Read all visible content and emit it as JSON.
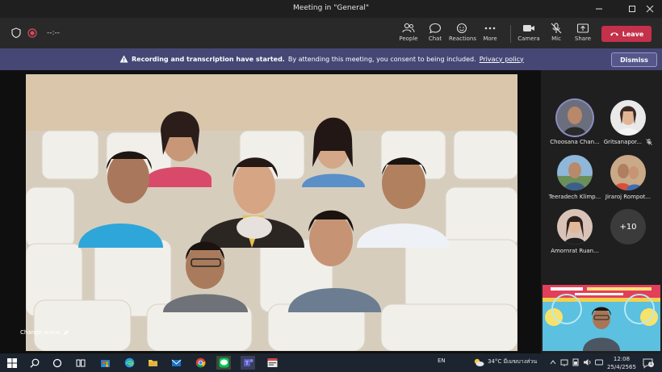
{
  "window": {
    "title": "Meeting in \"General\""
  },
  "toolbar": {
    "timer": "--:--",
    "people_label": "People",
    "chat_label": "Chat",
    "reactions_label": "Reactions",
    "more_label": "More",
    "camera_label": "Camera",
    "mic_label": "Mic",
    "share_label": "Share",
    "leave_label": "Leave"
  },
  "banner": {
    "bold": "Recording and transcription have started.",
    "text": "By attending this meeting, you consent to being included.",
    "link": "Privacy policy",
    "dismiss_label": "Dismiss"
  },
  "stage": {
    "change_scene_label": "Change scene"
  },
  "participants": [
    {
      "name": "Choosana Chan...",
      "speaking": true
    },
    {
      "name": "Gritsanapor...",
      "muted": true
    },
    {
      "name": "Teeradech Klimp..."
    },
    {
      "name": "Jiraroj Rompot..."
    },
    {
      "name": "Amornrat Ruan..."
    }
  ],
  "overflow_count": "+10",
  "taskbar": {
    "language": "EN",
    "weather": "34°C  มีเมฆบางส่วน",
    "time": "12:08",
    "date": "25/4/2565",
    "notification_count": "1"
  },
  "colors": {
    "leave": "#c4314b",
    "banner": "#464775",
    "accent": "#6264a7"
  }
}
